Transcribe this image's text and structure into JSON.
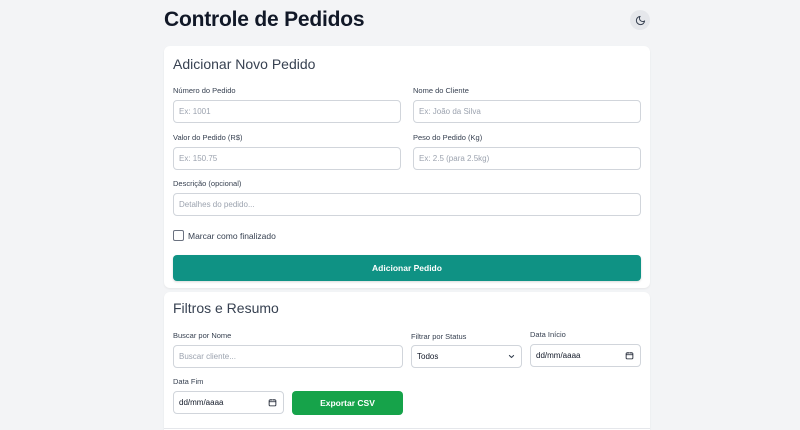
{
  "header": {
    "title": "Controle de Pedidos",
    "theme_icon": "moon-icon"
  },
  "add_form": {
    "title": "Adicionar Novo Pedido",
    "order_number": {
      "label": "Número do Pedido",
      "placeholder": "Ex: 1001"
    },
    "client_name": {
      "label": "Nome do Cliente",
      "placeholder": "Ex: João da Silva"
    },
    "order_value": {
      "label": "Valor do Pedido (R$)",
      "placeholder": "Ex: 150.75"
    },
    "order_weight": {
      "label": "Peso do Pedido (Kg)",
      "placeholder": "Ex: 2.5 (para 2.5kg)"
    },
    "description": {
      "label": "Descrição (opcional)",
      "placeholder": "Detalhes do pedido..."
    },
    "finalized_checkbox": {
      "label": "Marcar como finalizado",
      "checked": false
    },
    "submit_label": "Adicionar Pedido"
  },
  "filters": {
    "title": "Filtros e Resumo",
    "search": {
      "label": "Buscar por Nome",
      "placeholder": "Buscar cliente..."
    },
    "status": {
      "label": "Filtrar por Status",
      "value": "Todos"
    },
    "start_date": {
      "label": "Data Início",
      "value": "dd/mm/aaaa"
    },
    "end_date": {
      "label": "Data Fim",
      "value": "dd/mm/aaaa"
    },
    "export_label": "Exportar CSV"
  },
  "colors": {
    "primary": "#0f9284",
    "export": "#16a34a",
    "background": "#f3f4f6"
  }
}
